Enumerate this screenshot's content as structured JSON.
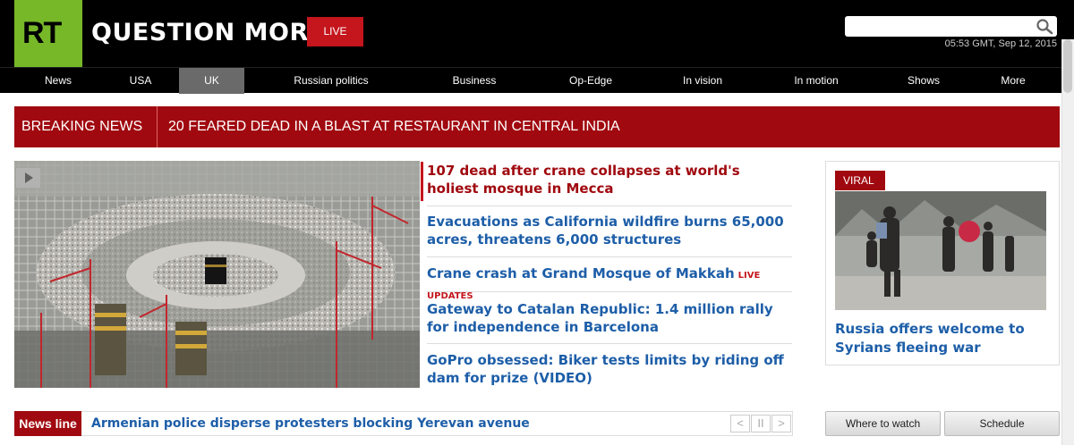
{
  "header": {
    "logo_text": "RT",
    "slogan": "QUESTION MORE",
    "live_label": "LIVE",
    "search_placeholder": "",
    "datetime": "05:53 GMT, Sep 12, 2015",
    "icons": {
      "search": "search-icon"
    }
  },
  "nav": {
    "items": [
      "News",
      "USA",
      "UK",
      "Russian politics",
      "Business",
      "Op-Edge",
      "In vision",
      "In motion",
      "Shows",
      "More"
    ],
    "active": "UK"
  },
  "breaking": {
    "label": "BREAKING NEWS",
    "text": "20 FEARED DEAD IN A BLAST AT RESTAURANT IN CENTRAL INDIA"
  },
  "headlines": [
    {
      "text": "107 dead after crane collapses at world's holiest mosque in Mecca",
      "tag": ""
    },
    {
      "text": "Evacuations as California wildfire burns 65,000 acres, threatens 6,000 structures",
      "tag": ""
    },
    {
      "text": "Crane crash at Grand Mosque of Makkah",
      "tag": "LIVE UPDATES"
    },
    {
      "text": "Gateway to Catalan Republic: 1.4 million rally for independence in Barcelona",
      "tag": ""
    },
    {
      "text": "GoPro obsessed: Biker tests limits by riding off dam for prize (VIDEO)",
      "tag": ""
    }
  ],
  "viral": {
    "tag": "VIRAL",
    "title": "Russia offers welcome to Syrians fleeing war"
  },
  "newsline": {
    "label": "News line",
    "text": "Armenian police disperse protesters blocking Yerevan avenue",
    "controls": [
      "<",
      "II",
      ">"
    ]
  },
  "buttons": {
    "where_to_watch": "Where to watch",
    "schedule": "Schedule"
  },
  "colors": {
    "brand_green": "#77b829",
    "brand_red": "#a0090f",
    "link_blue": "#1d5ea8"
  }
}
